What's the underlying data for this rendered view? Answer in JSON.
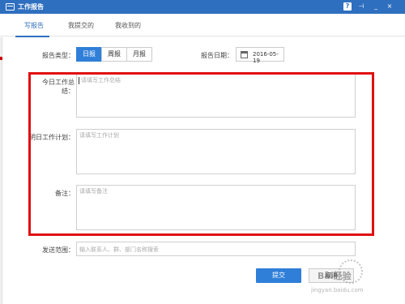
{
  "window": {
    "title": "工作报告",
    "help_glyph": "?",
    "pin_glyph": "⊣",
    "min_glyph": "_",
    "close_glyph": "×"
  },
  "tabs": [
    {
      "label": "写报告",
      "active": true
    },
    {
      "label": "我提交的",
      "active": false
    },
    {
      "label": "我收到的",
      "active": false
    }
  ],
  "report_type": {
    "label": "报告类型：",
    "options": [
      "日报",
      "周报",
      "月报"
    ],
    "selected": "日报"
  },
  "report_date": {
    "label": "报告日期：",
    "value": "2016-05-19"
  },
  "summary": {
    "label": "今日工作总结：",
    "placeholder": "请填写工作总结"
  },
  "plan": {
    "label": "明日工作计划：",
    "placeholder": "请填写工作计划"
  },
  "remarks": {
    "label": "备注：",
    "placeholder": "请填写备注"
  },
  "send_scope": {
    "label": "发送范围：",
    "placeholder": "输入联系人、群、部门名称搜索"
  },
  "buttons": {
    "submit": "提交",
    "cancel": "取消"
  },
  "watermark": {
    "text": "Bai经验",
    "url": "jingyan.baidu.com"
  },
  "colors": {
    "accent": "#2f7fd8",
    "titlebar": "#2f6fbf",
    "highlight": "#e01010"
  }
}
